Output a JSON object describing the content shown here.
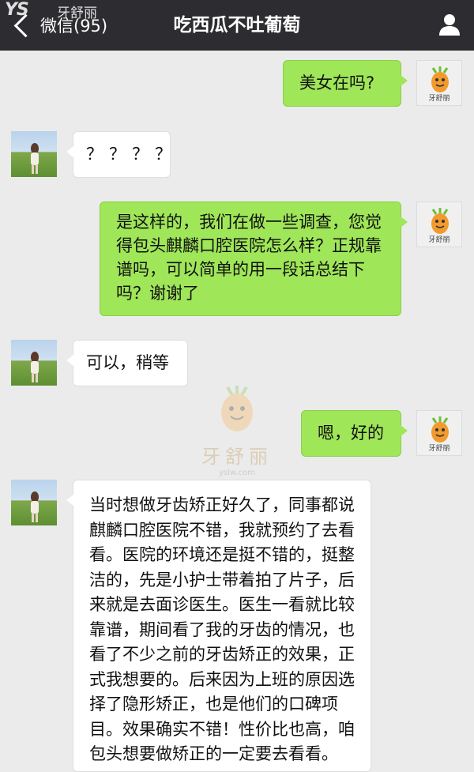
{
  "header": {
    "back_label": "微信(95)",
    "title": "吃西瓜不吐葡萄"
  },
  "watermark": {
    "mark": "YS",
    "brand": "牙舒丽",
    "url": "yslw.com"
  },
  "logo_avatar_text": "牙舒丽",
  "messages": [
    {
      "side": "me",
      "text": "美女在吗?"
    },
    {
      "side": "them",
      "text": "？？？？"
    },
    {
      "side": "me",
      "text": "是这样的，我们在做一些调查，您觉得包头麒麟口腔医院怎么样？正规靠谱吗，可以简单的用一段话总结下吗？谢谢了"
    },
    {
      "side": "them",
      "text": "可以，稍等"
    },
    {
      "side": "me",
      "text": "嗯，好的"
    },
    {
      "side": "them",
      "text": "当时想做牙齿矫正好久了，同事都说麒麟口腔医院不错，我就预约了去看看。医院的环境还是挺不错的，挺整洁的，先是小护士带着拍了片子，后来就是去面诊医生。医生一看就比较靠谱，期间看了我的牙齿的情况，也看了不少之前的牙齿矫正的效果，正式我想要的。后来因为上班的原因选择了隐形矫正，也是他们的口碑项目。效果确实不错！性价比也高，咱包头想要做矫正的一定要去看看。"
    }
  ]
}
